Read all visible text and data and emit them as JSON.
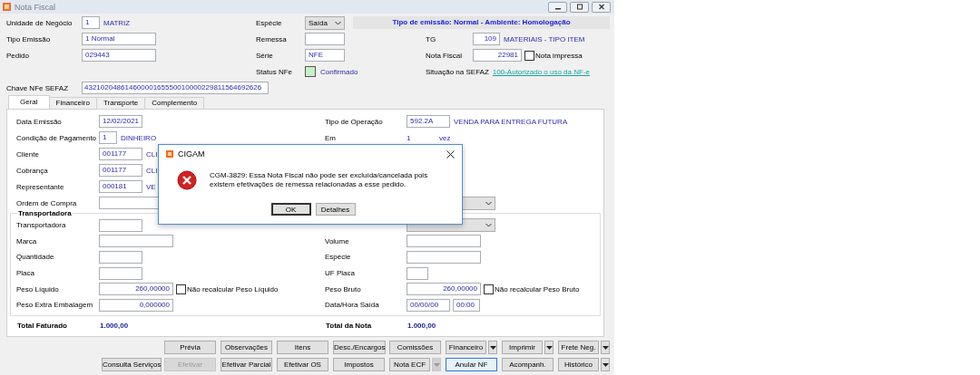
{
  "window": {
    "title": "Nota Fiscal"
  },
  "header": {
    "rows": [
      {
        "left": {
          "label": "Unidade de Negócio",
          "kind": "code",
          "value": "1",
          "name": "MATRIZ"
        },
        "middle": {
          "label": "Espécie",
          "kind": "select",
          "value": "Saída"
        },
        "right": {
          "kind": "banner",
          "text": "Tipo de emissão: Normal - Ambiente: Homologação"
        }
      },
      {
        "left": {
          "label": "Tipo Emissão",
          "kind": "medium",
          "value": "1 Normal"
        },
        "middle": {
          "label": "Remessa",
          "kind": "short"
        },
        "right": {
          "label": "TG",
          "kind": "code",
          "value": "109",
          "name": "MATERIAIS - TIPO ITEM"
        }
      },
      {
        "left": {
          "label": "Pedido",
          "kind": "medium",
          "value": "029443"
        },
        "middle": {
          "label": "Série",
          "kind": "short",
          "value": "NFE"
        },
        "right": {
          "label": "Nota Fiscal",
          "kind": "number",
          "value": "22981",
          "check": {
            "label": "Nota impressa",
            "checked": false
          }
        }
      },
      {
        "middle": {
          "label": "Status NFe",
          "kind": "status",
          "value": "Confirmado"
        },
        "right": {
          "label": "Situação na SEFAZ",
          "kind": "link",
          "value": "100-Autorizado o uso da NF-e"
        }
      },
      {
        "left": {
          "label": "Chave NFe SEFAZ",
          "kind": "long",
          "value": "43210204861460000165550010000229811564692626"
        }
      }
    ]
  },
  "tabs": [
    {
      "label": "Geral",
      "selected": true
    },
    {
      "label": "Financeiro",
      "selected": false
    },
    {
      "label": "Transporte",
      "selected": false
    },
    {
      "label": "Complemento",
      "selected": false
    }
  ],
  "geral": {
    "rows": [
      {
        "left": {
          "label": "Data Emissão",
          "kind": "short",
          "value": "12/02/2021"
        },
        "right": {
          "label": "Tipo de Operação",
          "kind": "short",
          "value": "592.2A",
          "name": "VENDA PARA ENTREGA FUTURA"
        }
      },
      {
        "left": {
          "label": "Condição de Pagamento",
          "kind": "code",
          "value": "1",
          "name": "DINHEIRO"
        },
        "right": {
          "label": "Em",
          "kind": "plain",
          "value": "1",
          "name": "vez"
        }
      },
      {
        "left": {
          "label": "Cliente",
          "kind": "short",
          "value": "001177",
          "name": "CLI"
        }
      },
      {
        "left": {
          "label": "Cobrança",
          "kind": "short",
          "value": "001177",
          "name": "CLI"
        }
      },
      {
        "left": {
          "label": "Representante",
          "kind": "short",
          "value": "000181",
          "name": "VE"
        }
      },
      {
        "left": {
          "label": "Ordem de Compra",
          "kind": "wide"
        },
        "right": {
          "kind": "select"
        }
      }
    ]
  },
  "transportadora": {
    "title": "Transportadora",
    "rows": [
      {
        "left": {
          "label": "Transportadora",
          "kind": "short"
        },
        "right": {
          "kind": "select"
        }
      },
      {
        "left": {
          "label": "Marca",
          "kind": "medium"
        },
        "right": {
          "label": "Volume",
          "kind": "medium"
        }
      },
      {
        "left": {
          "label": "Quantidade",
          "kind": "short"
        },
        "right": {
          "label": "Espécie",
          "kind": "medium"
        }
      },
      {
        "left": {
          "label": "Placa",
          "kind": "short"
        },
        "right": {
          "label": "UF Placa",
          "kind": "tiny"
        }
      },
      {
        "left": {
          "label": "Peso Líquido",
          "kind": "number",
          "value": "260,00000",
          "check": {
            "label": "Não recalcular Peso Líquido",
            "checked": false
          }
        },
        "right": {
          "label": "Peso Bruto",
          "kind": "number",
          "value": "260,00000",
          "check": {
            "label": "Não recalcular Peso Bruto",
            "checked": false
          }
        }
      },
      {
        "left": {
          "label": "Peso Extra Embalagem",
          "kind": "number",
          "value": "0,000000"
        },
        "right": {
          "label": "Data/Hora Saída",
          "kind": "datetime",
          "value": "00/00/00",
          "time": "00:00"
        }
      }
    ]
  },
  "totals": [
    {
      "label": "Total Faturado",
      "value": "1.000,00"
    },
    {
      "label": "Total da Nota",
      "value": "1.000,00"
    }
  ],
  "buttons": [
    [
      {
        "label": "Prévia",
        "disabled": false,
        "focused": false
      },
      {
        "label": "Observações",
        "disabled": false,
        "focused": false
      },
      {
        "label": "Itens",
        "disabled": false,
        "focused": false
      },
      {
        "label": "Desc./Encargos",
        "disabled": false,
        "focused": false
      },
      {
        "label": "Comissões",
        "disabled": false,
        "focused": false
      },
      {
        "label": "Financeiro",
        "disabled": false,
        "focused": false,
        "menu": {
          "disabled": false
        }
      },
      {
        "label": "Imprimir",
        "disabled": false,
        "focused": false,
        "menu": {
          "disabled": false
        }
      },
      {
        "label": "Frete Neg.",
        "disabled": false,
        "focused": false,
        "menu": {
          "disabled": false
        }
      }
    ],
    [
      {
        "label": "Consulta Serviços",
        "disabled": false,
        "focused": false
      },
      {
        "label": "Efetivar",
        "disabled": true,
        "focused": false
      },
      {
        "label": "Efetivar Parcial",
        "disabled": false,
        "focused": false
      },
      {
        "label": "Efetivar OS",
        "disabled": false,
        "focused": false
      },
      {
        "label": "Impostos",
        "disabled": false,
        "focused": false
      },
      {
        "label": "Nota ECF",
        "disabled": false,
        "focused": false,
        "menu": {
          "disabled": true
        }
      },
      {
        "label": "Anular NF",
        "disabled": false,
        "focused": true
      },
      {
        "label": "Acompanh.",
        "disabled": false,
        "focused": false
      },
      {
        "label": "Histórico",
        "disabled": false,
        "focused": false,
        "menu": {
          "disabled": false
        }
      }
    ]
  ],
  "dialog": {
    "title": "CIGAM",
    "message": "CGM-3829: Essa Nota Fiscal não pode ser excluída/cancelada pois existem efetivações de remessa relacionadas a esse pedido.",
    "buttons": [
      {
        "label": "OK",
        "focused": true
      },
      {
        "label": "Detalhes",
        "focused": false
      }
    ]
  }
}
